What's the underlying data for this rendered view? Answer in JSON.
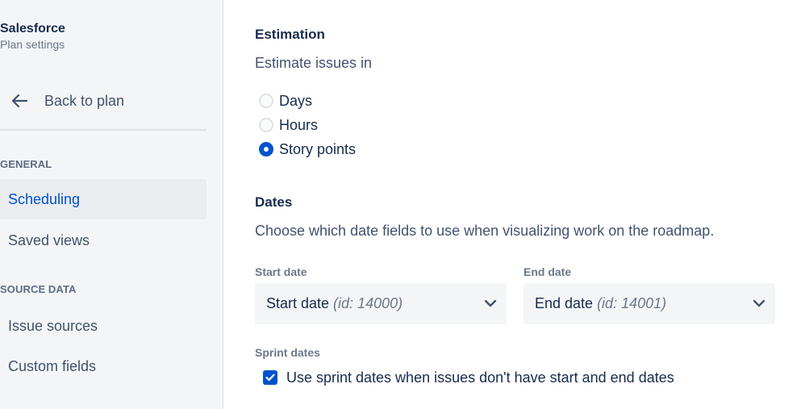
{
  "sidebar": {
    "project_name": "Salesforce",
    "project_sub": "Plan settings",
    "back_label": "Back to plan",
    "sections": [
      {
        "heading": "GENERAL",
        "items": [
          {
            "label": "Scheduling",
            "active": true
          },
          {
            "label": "Saved views",
            "active": false
          }
        ]
      },
      {
        "heading": "SOURCE DATA",
        "items": [
          {
            "label": "Issue sources",
            "active": false
          },
          {
            "label": "Custom fields",
            "active": false
          }
        ]
      }
    ]
  },
  "estimation": {
    "title": "Estimation",
    "prompt": "Estimate issues in",
    "options": [
      {
        "label": "Days",
        "selected": false
      },
      {
        "label": "Hours",
        "selected": false
      },
      {
        "label": "Story points",
        "selected": true
      }
    ]
  },
  "dates": {
    "title": "Dates",
    "description": "Choose which date fields to use when visualizing work on the roadmap.",
    "start": {
      "label": "Start date",
      "value": "Start date",
      "id_text": "(id: 14000)"
    },
    "end": {
      "label": "End date",
      "value": "End date",
      "id_text": "(id: 14001)"
    },
    "sprint": {
      "label": "Sprint dates",
      "checkbox_label": "Use sprint dates when issues don't have start and end dates",
      "checked": true
    }
  },
  "colors": {
    "accent": "#0052cc",
    "sidebar_bg": "#f4f5f7",
    "active_bg": "#ebecf0",
    "field_bg": "#f4f5f7"
  },
  "icons": {
    "back": "arrow-left-icon",
    "dropdown": "chevron-down-icon",
    "check": "checkmark-icon"
  }
}
